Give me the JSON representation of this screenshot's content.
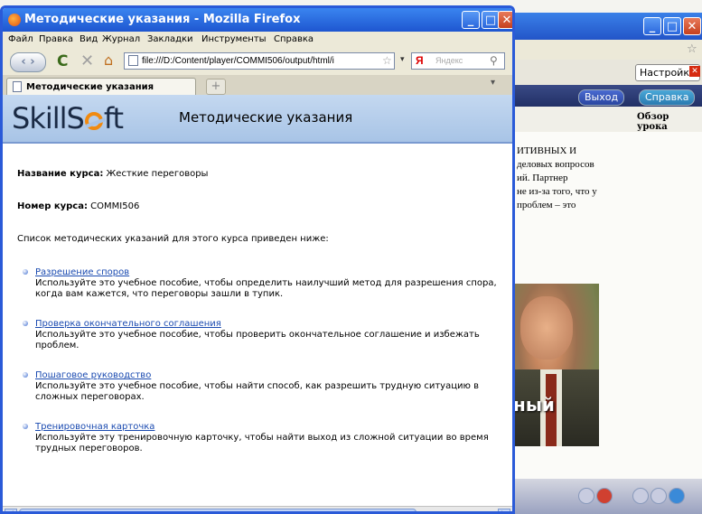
{
  "background_window": {
    "settings_label": "Настройки",
    "exit_label": "Выход",
    "help_label": "Справка",
    "overview_label": "Обзор урока",
    "body_lines": [
      "ИТИВНЫХ И",
      "деловых вопросов",
      "ий. Партнер",
      "не из-за того, что у",
      "проблем – это"
    ],
    "photo_caption": "ный",
    "close_glyph": "✕"
  },
  "window": {
    "title": "Методические указания - Mozilla Firefox",
    "minimize_glyph": "_",
    "maximize_glyph": "□",
    "close_glyph": "✕"
  },
  "menu": [
    "Файл",
    "Правка",
    "Вид",
    "Журнал",
    "Закладки",
    "Инструменты",
    "Справка"
  ],
  "nav": {
    "back_glyph": "‹ ›",
    "reload_glyph": "C",
    "stop_glyph": "✕",
    "home_glyph": "⌂",
    "url": "file:///D:/Content/player/COMMI506/output/html/i",
    "search_engine": "Я",
    "search_placeholder": "Яндекс"
  },
  "tabs": {
    "active_label": "Методические указания",
    "new_tab_glyph": "+"
  },
  "page": {
    "logo_pre": "SkillS",
    "logo_post": "ft",
    "header_title": "Методические указания",
    "course_name_label": "Название курса:",
    "course_name_value": "Жесткие переговоры",
    "course_number_label": "Номер курса:",
    "course_number_value": "COMMI506",
    "intro": "Список методических указаний для этого курса приведен ниже:",
    "items": [
      {
        "title": "Разрешение споров",
        "desc": "Используйте это учебное пособие, чтобы определить наилучший метод для разрешения спора, когда вам кажется, что переговоры зашли в тупик."
      },
      {
        "title": "Проверка окончательного соглашения",
        "desc": "Используйте это учебное пособие, чтобы проверить окончательное соглашение и избежать проблем."
      },
      {
        "title": "Пошаговое руководство",
        "desc": "Используйте это учебное пособие, чтобы найти способ, как разрешить трудную ситуацию в сложных переговорах."
      },
      {
        "title": "Тренировочная карточка",
        "desc": "Используйте эту тренировочную карточку, чтобы найти выход из сложной ситуации во время трудных переговоров."
      }
    ]
  }
}
